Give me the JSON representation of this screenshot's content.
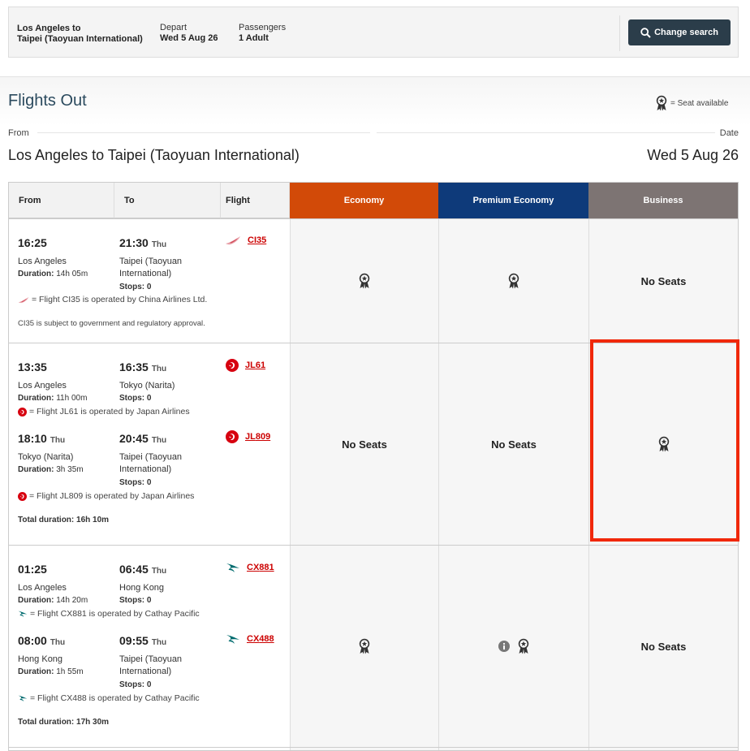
{
  "summary": {
    "route_line1": "Los Angeles  to",
    "route_line2": "Taipei (Taoyuan International)",
    "depart_label": "Depart",
    "depart_value": "Wed 5 Aug 26",
    "passengers_label": "Passengers",
    "passengers_value": "1 Adult",
    "change_button": "Change search"
  },
  "page": {
    "title": "Flights Out",
    "seat_key": "= Seat available",
    "from_label": "From",
    "date_label": "Date",
    "route": "Los Angeles to Taipei (Taoyuan International)",
    "date": "Wed 5 Aug 26"
  },
  "table": {
    "headers": {
      "from": "From",
      "to": "To",
      "flight": "Flight"
    },
    "cabins": [
      {
        "label": "Economy",
        "color": "#d24a08"
      },
      {
        "label": "Premium Economy",
        "color": "#0e3a7a"
      },
      {
        "label": "Business",
        "color": "#7d7473"
      }
    ],
    "no_seats": "No Seats"
  },
  "rows": [
    {
      "seg1": {
        "dep_time": "16:25",
        "arr_time": "21:30",
        "arr_day": "Thu",
        "from": "Los Angeles",
        "to_line1": "Taipei (Taoyuan",
        "to_line2": "International)",
        "duration_label": "Duration:",
        "duration": "14h 05m",
        "stops": "Stops: 0",
        "flight_prefix": "CI",
        "flight_num": "35",
        "airline_icon": "china-airlines-icon",
        "note": "= Flight CI35 is operated by China Airlines Ltd."
      },
      "extra": "CI35 is subject to government and regulatory approval."
    },
    {
      "seg1": {
        "dep_time": "13:35",
        "arr_time": "16:35",
        "arr_day": "Thu",
        "from": "Los Angeles",
        "to_line1": "Tokyo (Narita)",
        "duration_label": "Duration:",
        "duration": "11h 00m",
        "stops": "Stops: 0",
        "flight_prefix": "JL",
        "flight_num": "61",
        "airline_icon": "japan-airlines-icon",
        "note": "= Flight JL61 is operated by Japan Airlines"
      },
      "seg2": {
        "dep_time": "18:10",
        "dep_day": "Thu",
        "arr_time": "20:45",
        "arr_day": "Thu",
        "from": "Tokyo (Narita)",
        "to_line1": "Taipei (Taoyuan",
        "to_line2": "International)",
        "duration_label": "Duration:",
        "duration": "3h 35m",
        "stops": "Stops: 0",
        "flight_prefix": "JL",
        "flight_num": "809",
        "airline_icon": "japan-airlines-icon",
        "note": "= Flight JL809 is operated by Japan Airlines"
      },
      "total_label": "Total duration:",
      "total": "16h 10m"
    },
    {
      "seg1": {
        "dep_time": "01:25",
        "arr_time": "06:45",
        "arr_day": "Thu",
        "from": "Los Angeles",
        "to_line1": "Hong Kong",
        "duration_label": "Duration:",
        "duration": "14h 20m",
        "stops": "Stops: 0",
        "flight_prefix": "CX",
        "flight_num": "881",
        "airline_icon": "cathay-pacific-icon",
        "note": "= Flight CX881 is operated by Cathay Pacific"
      },
      "seg2": {
        "dep_time": "08:00",
        "dep_day": "Thu",
        "arr_time": "09:55",
        "arr_day": "Thu",
        "from": "Hong Kong",
        "to_line1": "Taipei (Taoyuan",
        "to_line2": "International)",
        "duration_label": "Duration:",
        "duration": "1h 55m",
        "stops": "Stops: 0",
        "flight_prefix": "CX",
        "flight_num": "488",
        "airline_icon": "cathay-pacific-icon",
        "note": "= Flight CX488 is operated by Cathay Pacific"
      },
      "total_label": "Total duration:",
      "total": "17h 30m"
    }
  ]
}
